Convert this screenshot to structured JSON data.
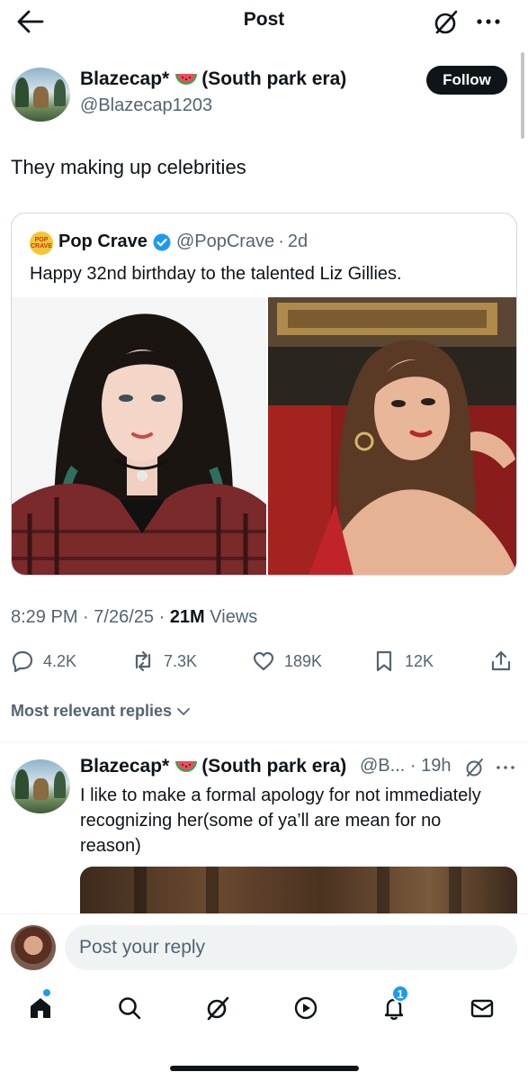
{
  "header": {
    "title": "Post",
    "back_icon": "arrow-left-icon",
    "grok_icon": "grok-icon",
    "more_icon": "more-horizontal-icon"
  },
  "post": {
    "author_name": "Blazecap*",
    "author_suffix": "(South park era)",
    "author_handle": "@Blazecap1203",
    "follow_label": "Follow",
    "text": "They making up celebrities",
    "quote": {
      "logo_text_top": "POP",
      "logo_text_bottom": "CRAVE",
      "name": "Pop Crave",
      "handle": "@PopCrave",
      "separator": "·",
      "time": "2d",
      "text": "Happy 32nd birthday to the talented Liz Gillies."
    },
    "meta": {
      "time": "8:29 PM",
      "sep1": "·",
      "date": "7/26/25",
      "sep2": "·",
      "views_count": "21M",
      "views_label": "Views"
    },
    "actions": {
      "replies": "4.2K",
      "reposts": "7.3K",
      "likes": "189K",
      "bookmarks": "12K"
    }
  },
  "replies_sort_label": "Most relevant replies",
  "reply": {
    "author_name": "Blazecap*",
    "author_suffix": "(South park era)",
    "handle_truncated": "@B...",
    "separator": "·",
    "time": "19h",
    "text": "I like to make a formal apology for not immediately recognizing her(some of ya’ll are mean for no reason)"
  },
  "composer": {
    "placeholder": "Post your reply"
  },
  "tabbar": {
    "items": [
      "home-icon",
      "search-icon",
      "grok-icon",
      "video-icon",
      "notifications-icon",
      "messages-icon"
    ],
    "notifications_badge": "1"
  },
  "colors": {
    "accent": "#1d9bf0",
    "text": "#0f1419",
    "muted": "#536471",
    "border": "#cfd9de"
  }
}
